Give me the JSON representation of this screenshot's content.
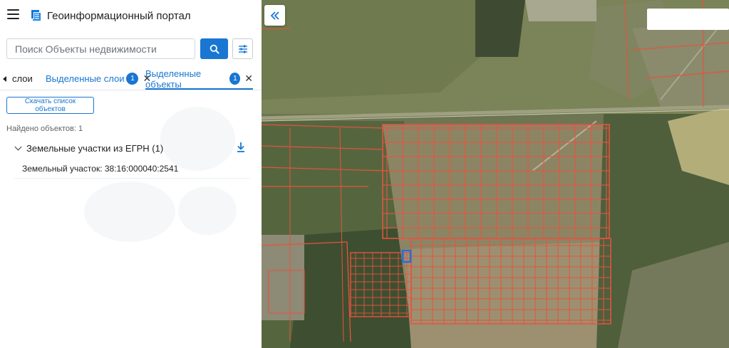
{
  "header": {
    "menu_icon": "hamburger-menu-icon",
    "logo_icon": "portal-logo-icon",
    "title": "Геоинформационный портал"
  },
  "search": {
    "placeholder": "Поиск Объекты недвижимости",
    "value": "",
    "search_icon": "search-icon",
    "filter_icon": "sliders-filter-icon"
  },
  "tabs": {
    "layers_label": "слои",
    "selected_layers_label": "Выделенные слои",
    "selected_layers_count": "1",
    "selected_objects_label": "Выделенные объекты",
    "selected_objects_count": "1",
    "close_icon": "close-icon"
  },
  "results": {
    "download_list_label": "Скачать список объектов",
    "found_label": "Найдено объектов: 1",
    "group_title": "Земельные участки из ЕГРН (1)",
    "group_download_icon": "download-icon",
    "items": [
      {
        "label": "Земельный участок: 38:16:000040:2541"
      }
    ]
  },
  "map": {
    "collapse_icon": "double-chevron-left-icon",
    "parcel_color": "#e8523e",
    "selected_parcel_color": "#1e6fe0"
  },
  "colors": {
    "accent": "#1976d2"
  }
}
